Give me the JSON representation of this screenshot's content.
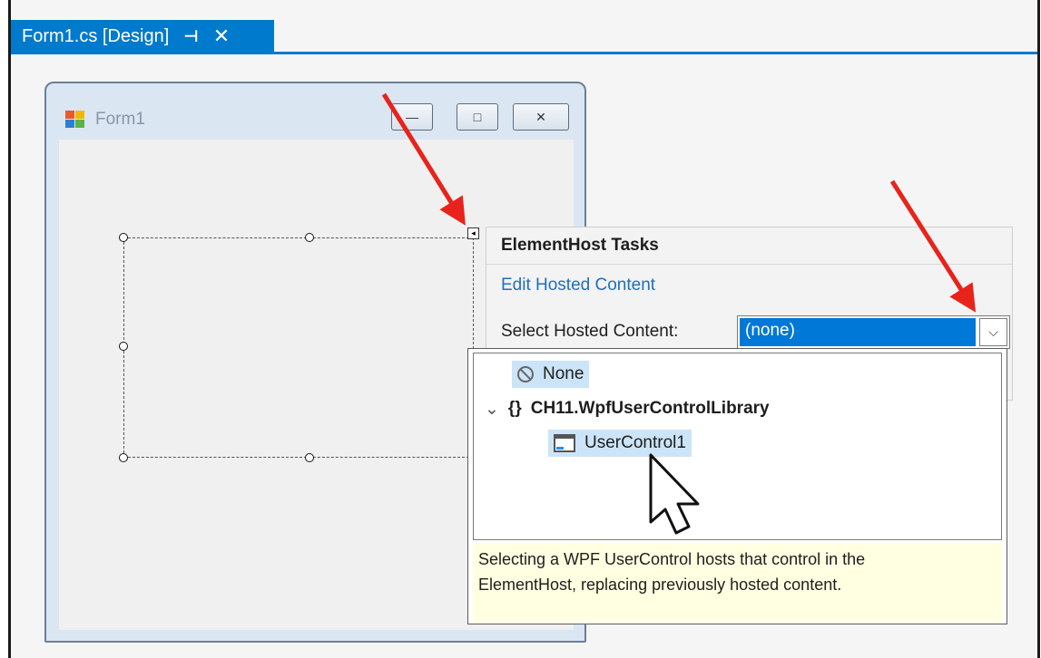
{
  "tab": {
    "title": "Form1.cs [Design]",
    "pin_glyph": "⊣",
    "close_glyph": "✕"
  },
  "form": {
    "title": "Form1",
    "minimize_glyph": "—",
    "maximize_glyph": "□",
    "close_glyph": "✕"
  },
  "smart_tag_glyph": "◂",
  "tasks": {
    "header": "ElementHost Tasks",
    "link": "Edit Hosted Content",
    "select_label": "Select Hosted Content:",
    "select_value": "(none)",
    "dropdown_glyph": "⌵"
  },
  "tree": {
    "none_label": "None",
    "namespace_chevron": "⌄",
    "namespace_icon": "{}",
    "namespace_label": "CH11.WpfUserControlLibrary",
    "control_label": "UserControl1"
  },
  "tooltip": {
    "line1": "Selecting a WPF UserControl hosts that control in the",
    "line2": "ElementHost, replacing previously hosted content."
  },
  "colors": {
    "accent": "#007acc",
    "selection": "#0078d7",
    "annotation_arrow": "#e8231c",
    "tooltip_bg": "#ffffe1"
  }
}
